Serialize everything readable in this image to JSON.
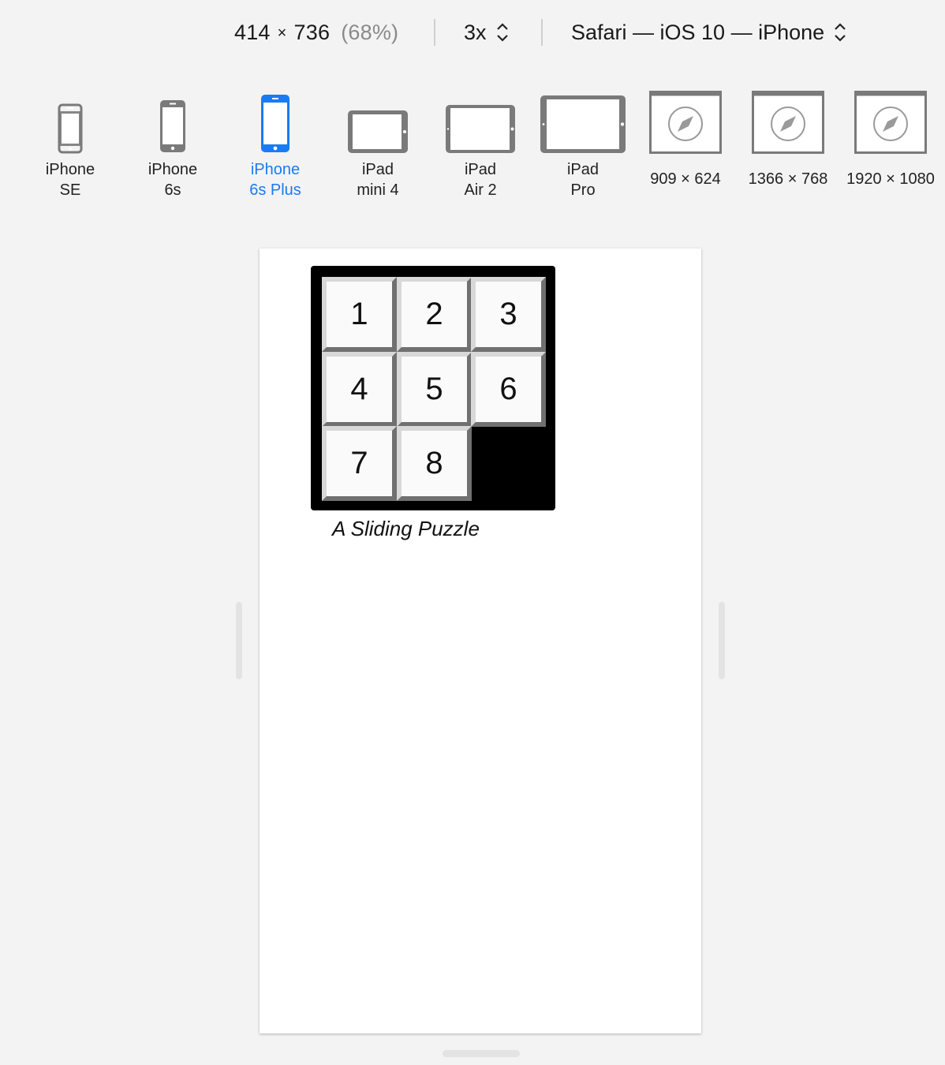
{
  "toolbar": {
    "width": "414",
    "times": "×",
    "height": "736",
    "zoom": "(68%)",
    "pixel_ratio": "3x",
    "user_agent": "Safari — iOS 10 — iPhone"
  },
  "devices": [
    {
      "line1": "iPhone",
      "line2": "SE"
    },
    {
      "line1": "iPhone",
      "line2": "6s"
    },
    {
      "line1": "iPhone",
      "line2": "6s Plus"
    },
    {
      "line1": "iPad",
      "line2": "mini 4"
    },
    {
      "line1": "iPad",
      "line2": "Air 2"
    },
    {
      "line1": "iPad",
      "line2": "Pro"
    },
    {
      "line1": "909 × 624"
    },
    {
      "line1": "1366 × 768"
    },
    {
      "line1": "1920 × 1080"
    }
  ],
  "selected_device": "iPhone 6s Plus",
  "colors": {
    "accent": "#1a7bf2",
    "icon": "#7a7a7a"
  },
  "puzzle": {
    "tiles": [
      "1",
      "2",
      "3",
      "4",
      "5",
      "6",
      "7",
      "8"
    ],
    "empty_slot": "row 3, column 3",
    "caption": "A Sliding Puzzle"
  }
}
